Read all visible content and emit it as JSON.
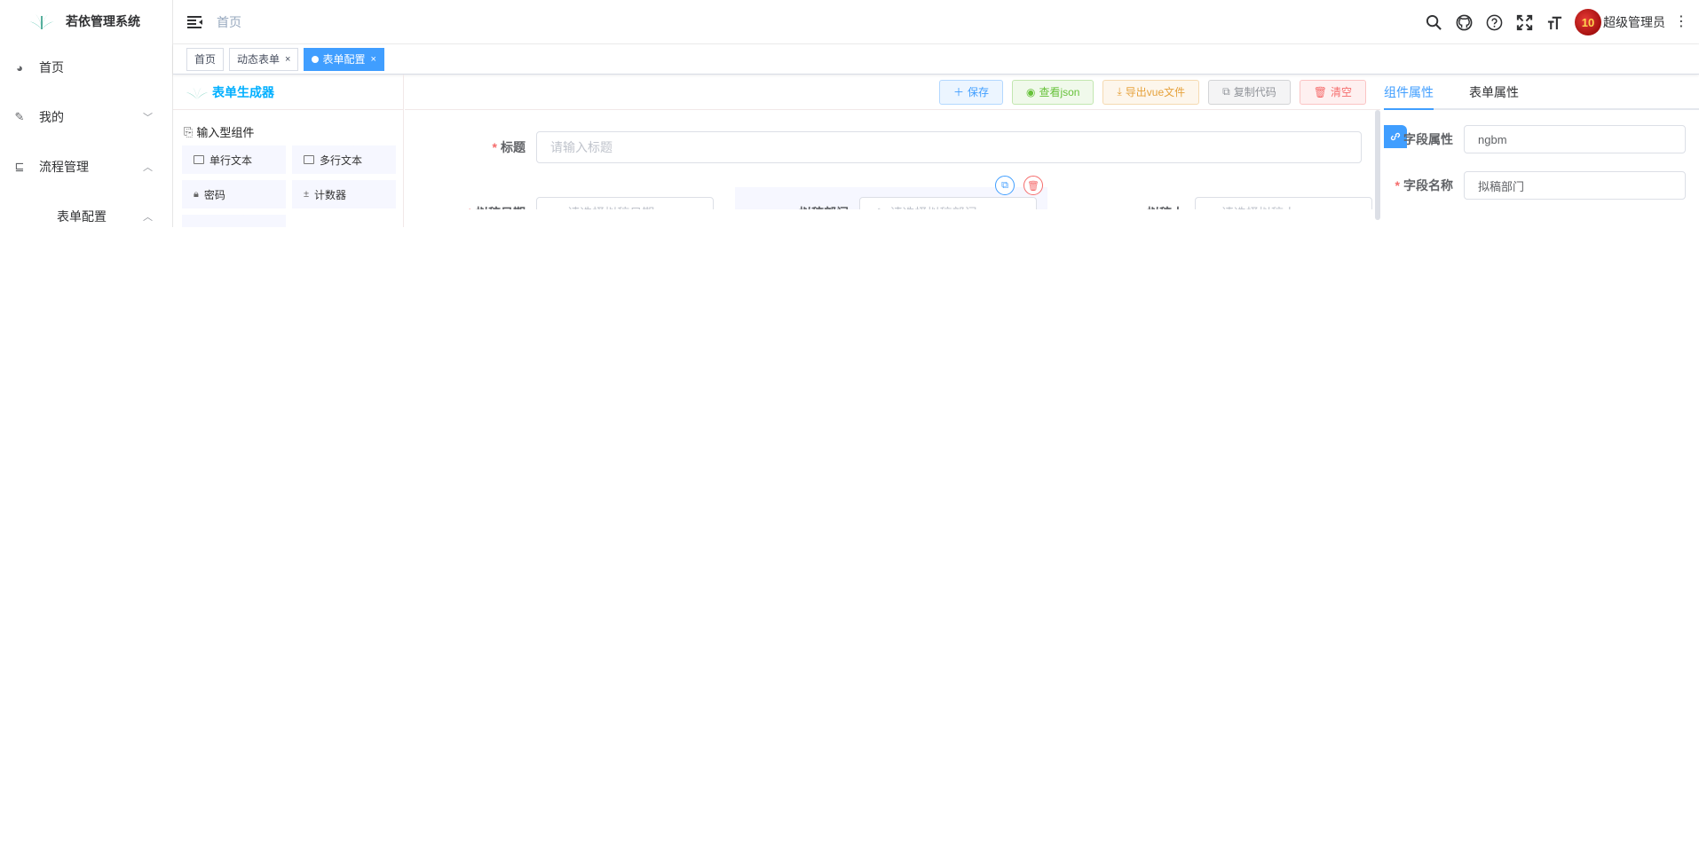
{
  "app": {
    "title": "若依管理系统"
  },
  "sidebar": {
    "items": [
      {
        "label": "首页",
        "icon": "dashboard-icon"
      },
      {
        "label": "我的",
        "icon": "edit-icon",
        "arrow": "chevron-down-icon"
      },
      {
        "label": "流程管理",
        "icon": "tree-icon",
        "arrow": "chevron-up-icon"
      }
    ],
    "sub_items": [
      {
        "label": "表单配置",
        "arrow": "chevron-up-icon"
      }
    ]
  },
  "navbar": {
    "breadcrumb": "首页",
    "username": "超级管理员",
    "avatar_text": "10"
  },
  "tags": [
    {
      "label": "首页",
      "closable": false
    },
    {
      "label": "动态表单",
      "closable": true
    },
    {
      "label": "表单配置",
      "closable": true,
      "active": true
    }
  ],
  "builder": {
    "title": "表单生成器",
    "group_title": "输入型组件",
    "components": [
      {
        "label": "单行文本"
      },
      {
        "label": "多行文本"
      },
      {
        "label": "密码"
      },
      {
        "label": "计数器"
      }
    ],
    "toolbar": {
      "save": "保存",
      "json": "查看json",
      "vue": "导出vue文件",
      "copy": "复制代码",
      "clear": "清空"
    },
    "form": {
      "title_label": "标题",
      "title_placeholder": "请输入标题",
      "date_label": "拟稿日期",
      "date_placeholder": "请选择拟稿日期",
      "dept_label": "拟稿部门",
      "dept_placeholder": "请选择拟稿部门",
      "person_label": "拟稿人",
      "person_placeholder": "请选择拟稿人"
    }
  },
  "right_panel": {
    "tabs": [
      {
        "label": "组件属性",
        "active": true
      },
      {
        "label": "表单属性",
        "active": false
      }
    ],
    "field_attr_label": "字段属性",
    "field_attr_value": "ngbm",
    "field_name_label": "字段名称",
    "field_name_value": "拟稿部门"
  },
  "colors": {
    "primary": "#409eff",
    "brand_title": "#00afff",
    "danger": "#f56c6c"
  }
}
